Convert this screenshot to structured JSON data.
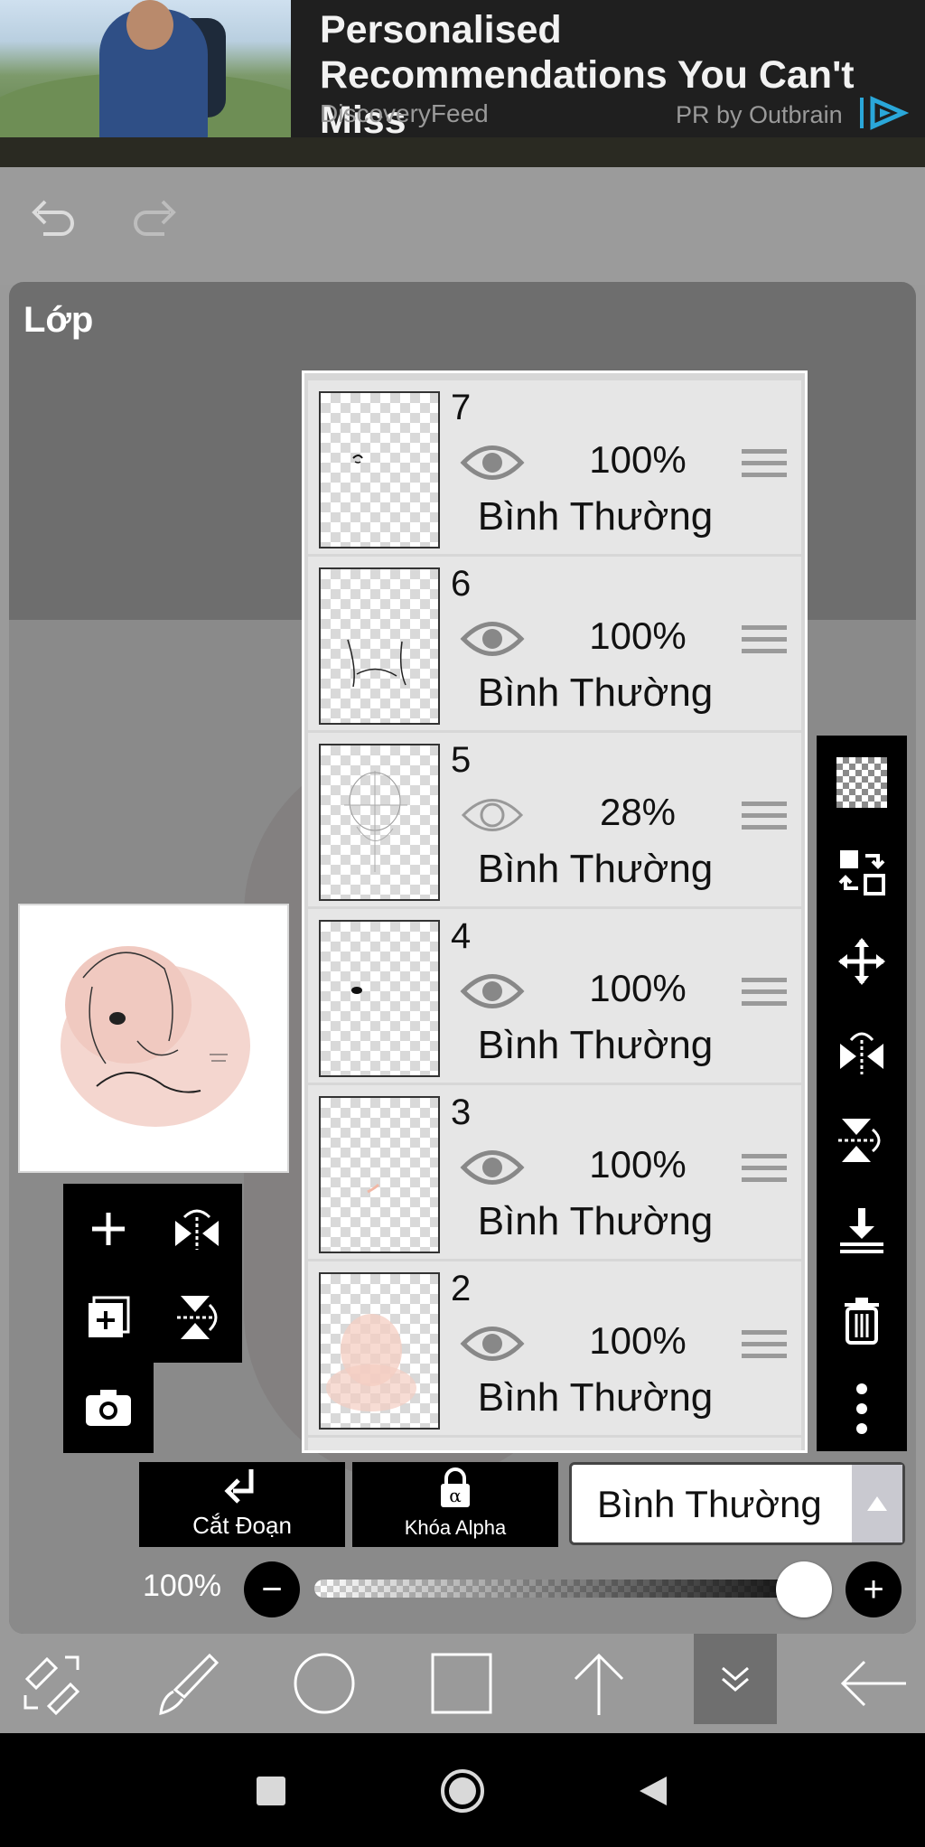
{
  "ad": {
    "title": "Personalised Recommendations You Can't Miss",
    "source": "DiscoveryFeed",
    "pr": "PR by Outbrain"
  },
  "panel": {
    "title": "Lớp"
  },
  "layers": [
    {
      "number": "7",
      "opacity": "100%",
      "blend": "Bình Thường"
    },
    {
      "number": "6",
      "opacity": "100%",
      "blend": "Bình Thường"
    },
    {
      "number": "5",
      "opacity": "28%",
      "blend": "Bình Thường"
    },
    {
      "number": "4",
      "opacity": "100%",
      "blend": "Bình Thường"
    },
    {
      "number": "3",
      "opacity": "100%",
      "blend": "Bình Thường"
    },
    {
      "number": "2",
      "opacity": "100%",
      "blend": "Bình Thường"
    }
  ],
  "actions": {
    "clip_label": "Cắt Đoạn",
    "alpha_lock_label": "Khóa Alpha",
    "blend_mode": "Bình Thường"
  },
  "opacity_slider": {
    "label": "100%",
    "value": 1.0,
    "minus": "−",
    "plus": "+"
  },
  "colors": {
    "panel_bg": "#6e6e6e",
    "row_bg": "#e6e6e6",
    "active_tool": "#6f6f6f"
  }
}
